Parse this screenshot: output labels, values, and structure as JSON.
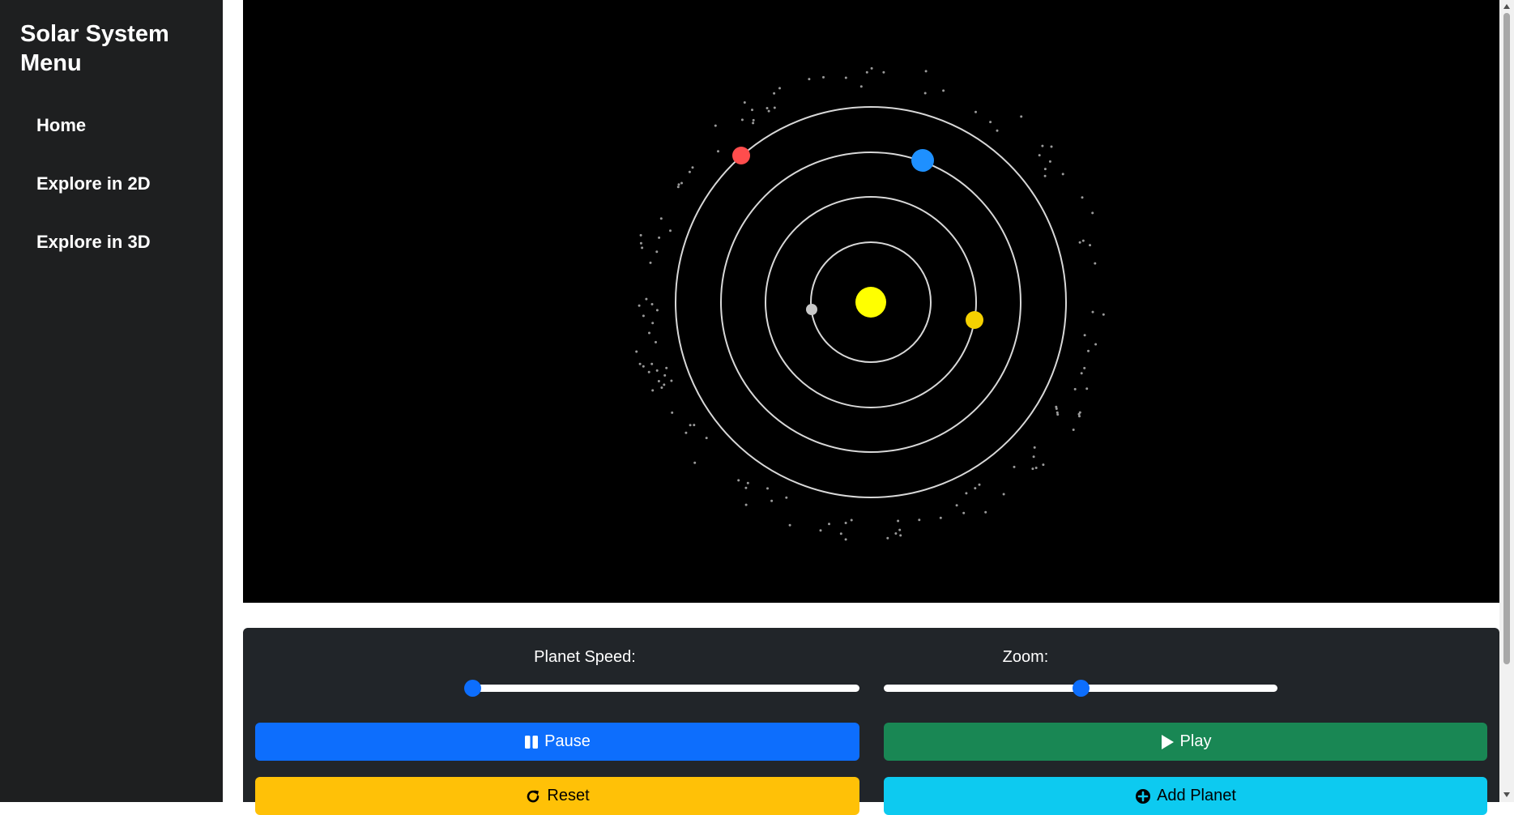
{
  "sidebar": {
    "title": "Solar System Menu",
    "items": [
      {
        "label": "Home"
      },
      {
        "label": "Explore in 2D"
      },
      {
        "label": "Explore in 3D"
      }
    ]
  },
  "scene": {
    "sun_color": "#ffff00",
    "orbit_color": "#d8d8d8",
    "background": "#000000",
    "planet_colors": [
      "#c8c8c8",
      "#f5d100",
      "#1e90ff",
      "#ff4d4d"
    ]
  },
  "controls": {
    "speed": {
      "label": "Planet Speed:",
      "value": 0
    },
    "zoom": {
      "label": "Zoom:",
      "value": 0.5
    },
    "buttons": {
      "pause": {
        "label": "Pause",
        "icon": "pause-icon",
        "color": "#0d6efd"
      },
      "play": {
        "label": "Play",
        "icon": "play-icon",
        "color": "#198754"
      },
      "reset": {
        "label": "Reset",
        "icon": "rotate-icon",
        "color": "#ffc107"
      },
      "add_planet": {
        "label": "Add Planet",
        "icon": "plus-circle-icon",
        "color": "#0dcaf0"
      }
    }
  }
}
